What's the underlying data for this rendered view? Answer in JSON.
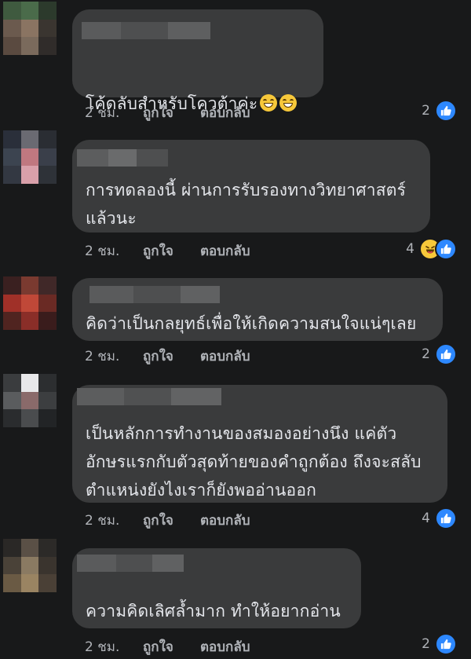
{
  "comments": [
    {
      "text": "โค้ดลับสำหรับโควต้าค่ะ",
      "emoji": [
        "grinning-face-emoji",
        "grinning-face-emoji"
      ],
      "time": "2 ชม.",
      "like_label": "ถูกใจ",
      "reply_label": "ตอบกลับ",
      "reaction_count": "2",
      "reactions": [
        "like-icon"
      ]
    },
    {
      "text": "การทดลองนี้ ผ่านการรับรองทางวิทยาศาสตร์\nแล้วนะ",
      "time": "2 ชม.",
      "like_label": "ถูกใจ",
      "reply_label": "ตอบกลับ",
      "reaction_count": "4",
      "reactions": [
        "haha-icon",
        "like-icon"
      ]
    },
    {
      "text": "คิดว่าเป็นกลยุทธ์เพื่อให้เกิดความสนใจแน่ๆเลย",
      "time": "2 ชม.",
      "like_label": "ถูกใจ",
      "reply_label": "ตอบกลับ",
      "reaction_count": "2",
      "reactions": [
        "like-icon"
      ]
    },
    {
      "text": "เป็นหลักการทำงานของสมองอย่างนึง แค่ตัว\nอักษรแรกกับตัวสุดท้ายของคำถูกต้อง ถึงจะสลับ\nตำแหน่งยังไงเราก็ยังพออ่านออก",
      "time": "2 ชม.",
      "like_label": "ถูกใจ",
      "reply_label": "ตอบกลับ",
      "reaction_count": "4",
      "reactions": [
        "like-icon"
      ]
    },
    {
      "text": "ความคิดเลิศล้ำมาก ทำให้อยากอ่าน",
      "time": "2 ชม.",
      "like_label": "ถูกใจ",
      "reply_label": "ตอบกลับ",
      "reaction_count": "2",
      "reactions": [
        "like-icon"
      ]
    }
  ],
  "colors": {
    "background": "#18191a",
    "bubble": "#3a3b3c",
    "text": "#e4e6eb",
    "secondary_text": "#b0b3b8",
    "like_blue": "#2d88ff",
    "haha_yellow": "#f7c83a"
  }
}
